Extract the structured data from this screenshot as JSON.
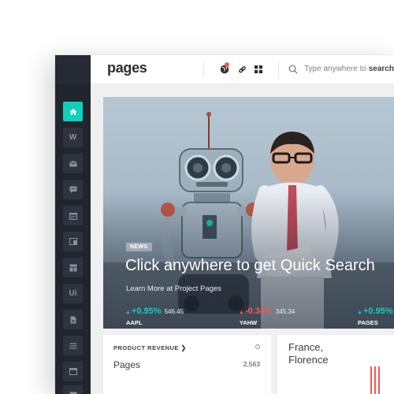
{
  "header": {
    "logo": "pages",
    "search_prefix": "Type anywhere to ",
    "search_bold": "search"
  },
  "sidebar": {
    "items": [
      {
        "icon": "home-icon",
        "label": "",
        "active": true
      },
      {
        "icon": "w-icon",
        "label": "W",
        "active": false
      },
      {
        "icon": "mail-icon",
        "label": "",
        "active": false
      },
      {
        "icon": "chat-icon",
        "label": "",
        "active": false
      },
      {
        "icon": "calendar-icon",
        "label": "",
        "active": false
      },
      {
        "icon": "layout-icon",
        "label": "",
        "active": false
      },
      {
        "icon": "grid-icon",
        "label": "",
        "active": false
      },
      {
        "icon": "ui-icon",
        "label": "Ui",
        "active": false
      },
      {
        "icon": "document-icon",
        "label": "",
        "active": false
      },
      {
        "icon": "list-icon",
        "label": "",
        "active": false
      },
      {
        "icon": "window-icon",
        "label": "",
        "active": false
      },
      {
        "icon": "table-icon",
        "label": "",
        "active": false
      }
    ]
  },
  "hero": {
    "badge": "NEWS",
    "title": "Click anywhere to get Quick Search",
    "subtitle": "Learn More at Project Pages",
    "tickers": [
      {
        "change": "+0.95%",
        "price": "546.45",
        "symbol": "AAPL",
        "direction": "up"
      },
      {
        "change": "-0.34%",
        "price": "345.34",
        "symbol": "YAHW",
        "direction": "down"
      },
      {
        "change": "+0.95%",
        "price": "",
        "symbol": "PAGES",
        "direction": "up"
      }
    ]
  },
  "cards": {
    "revenue": {
      "title": "PRODUCT REVENUE",
      "row_label": "Pages",
      "row_value": "2,563"
    },
    "location": {
      "line1": "France,",
      "line2": "Florence"
    }
  },
  "colors": {
    "accent": "#10cfbd",
    "danger": "#f55753",
    "sidebar_bg": "#21252d"
  }
}
